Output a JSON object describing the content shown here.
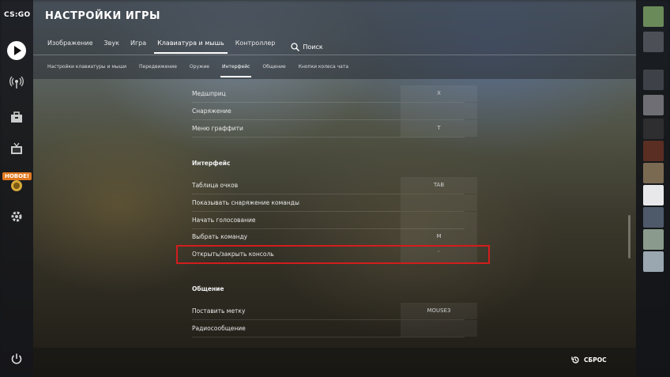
{
  "app": {
    "logo": "CS:GO",
    "new_badge": "НОВОЕ!"
  },
  "header": {
    "title": "НАСТРОЙКИ ИГРЫ",
    "tabs": [
      {
        "label": "Изображение",
        "active": false
      },
      {
        "label": "Звук",
        "active": false
      },
      {
        "label": "Игра",
        "active": false
      },
      {
        "label": "Клавиатура и мышь",
        "active": true
      },
      {
        "label": "Контроллер",
        "active": false
      }
    ],
    "search_label": "Поиск"
  },
  "subtabs": [
    {
      "label": "Настройки клавиатуры и мыши",
      "active": false
    },
    {
      "label": "Передвижение",
      "active": false
    },
    {
      "label": "Оружие",
      "active": false
    },
    {
      "label": "Интерфейс",
      "active": true
    },
    {
      "label": "Общение",
      "active": false
    },
    {
      "label": "Кнопки колеса чата",
      "active": false
    }
  ],
  "rows_top": [
    {
      "label": "Медшприц",
      "value": "X"
    },
    {
      "label": "Снаряжение",
      "value": ""
    },
    {
      "label": "Меню граффити",
      "value": "T"
    }
  ],
  "section_interface": "Интерфейс",
  "rows_interface": [
    {
      "label": "Таблица очков",
      "value": "TAB"
    },
    {
      "label": "Показывать снаряжение команды",
      "value": ""
    },
    {
      "label": "Начать голосование",
      "value": ""
    },
    {
      "label": "Выбрать команду",
      "value": "M"
    },
    {
      "label": "Открыть/закрыть консоль",
      "value": "`"
    }
  ],
  "section_communication": "Общение",
  "rows_communication": [
    {
      "label": "Поставить метку",
      "value": "MOUSE3"
    },
    {
      "label": "Радиосообщение",
      "value": ""
    }
  ],
  "footer": {
    "reset_label": "СБРОС"
  },
  "colors": {
    "highlight": "#d21d1d",
    "accent_badge": "#e0781e"
  }
}
